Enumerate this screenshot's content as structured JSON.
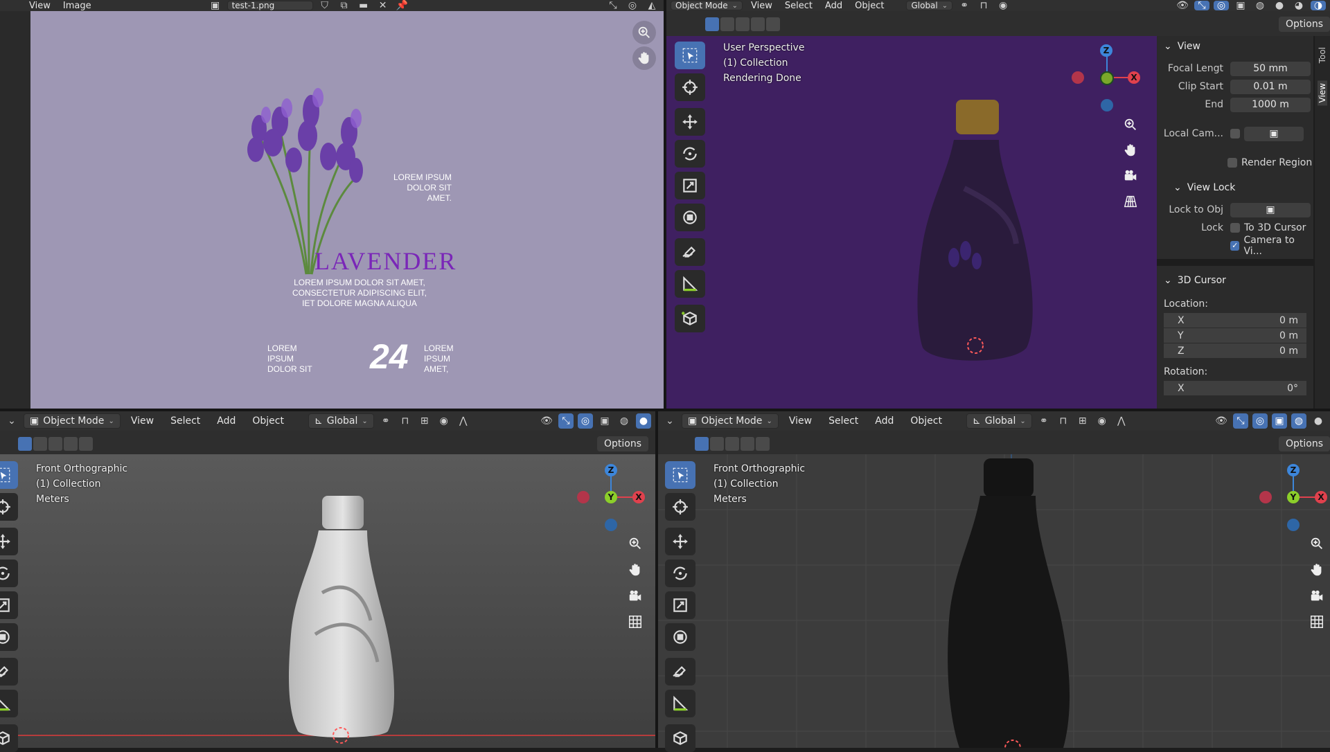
{
  "image_editor": {
    "menu": [
      "View",
      "Image"
    ],
    "file_name": "test-1.png"
  },
  "label": {
    "brand": "LAVENDER",
    "side_text": [
      "LOREM IPSUM",
      "DOLOR SIT",
      "AMET."
    ],
    "body_text": [
      "LOREM IPSUM DOLOR SIT AMET,",
      "CONSECTETUR ADIPISCING ELIT,",
      "IET DOLORE MAGNA ALIQUA"
    ],
    "bottom_left": [
      "LOREM",
      "IPSUM",
      "DOLOR SIT"
    ],
    "number": "24",
    "bottom_right": [
      "LOREM",
      "IPSUM",
      "AMET,"
    ]
  },
  "top_right": {
    "mode": "Object Mode",
    "menu": [
      "View",
      "Select",
      "Add",
      "Object"
    ],
    "transform": "Global",
    "options_label": "Options",
    "overlay": [
      "User Perspective",
      "(1) Collection",
      "Rendering Done"
    ],
    "gizmo": {
      "z": "Z",
      "x": "X"
    }
  },
  "npanel": {
    "view_header": "View",
    "focal_label": "Focal Lengt",
    "focal_value": "50 mm",
    "clip_start_label": "Clip Start",
    "clip_start_value": "0.01 m",
    "end_label": "End",
    "end_value": "1000 m",
    "local_cam_label": "Local Cam...",
    "render_region": "Render Region",
    "view_lock_header": "View Lock",
    "lock_to_obj": "Lock to Obj",
    "lock_label": "Lock",
    "to_3d_cursor": "To 3D Cursor",
    "camera_to_view": "Camera to Vi...",
    "cursor_header": "3D Cursor",
    "location_label": "Location:",
    "loc": [
      {
        "axis": "X",
        "value": "0 m"
      },
      {
        "axis": "Y",
        "value": "0 m"
      },
      {
        "axis": "Z",
        "value": "0 m"
      }
    ],
    "rotation_label": "Rotation:",
    "rot_x": {
      "axis": "X",
      "value": "0°"
    },
    "tabs": [
      "Tool",
      "View"
    ]
  },
  "bottom_left": {
    "mode": "Object Mode",
    "menu": [
      "View",
      "Select",
      "Add",
      "Object"
    ],
    "transform": "Global",
    "options_label": "Options",
    "overlay": [
      "Front Orthographic",
      "(1) Collection",
      "Meters"
    ],
    "gizmo": {
      "z": "Z",
      "y": "Y",
      "x": "X"
    }
  },
  "bottom_right": {
    "mode": "Object Mode",
    "menu": [
      "View",
      "Select",
      "Add",
      "Object"
    ],
    "transform": "Global",
    "options_label": "Options",
    "overlay": [
      "Front Orthographic",
      "(1) Collection",
      "Meters"
    ],
    "gizmo": {
      "z": "Z",
      "y": "Y",
      "x": "X"
    }
  },
  "colors": {
    "image_bg": "#9e97b4",
    "render_bg": "#3f2061",
    "solid_bg": "#4a4a4a",
    "dark_bg": "#3c3c3c",
    "accent": "#4772b3",
    "axis_x": "#e0414d",
    "axis_y": "#8ccf2a",
    "axis_z": "#3d86da",
    "brand": "#7a26b8"
  }
}
